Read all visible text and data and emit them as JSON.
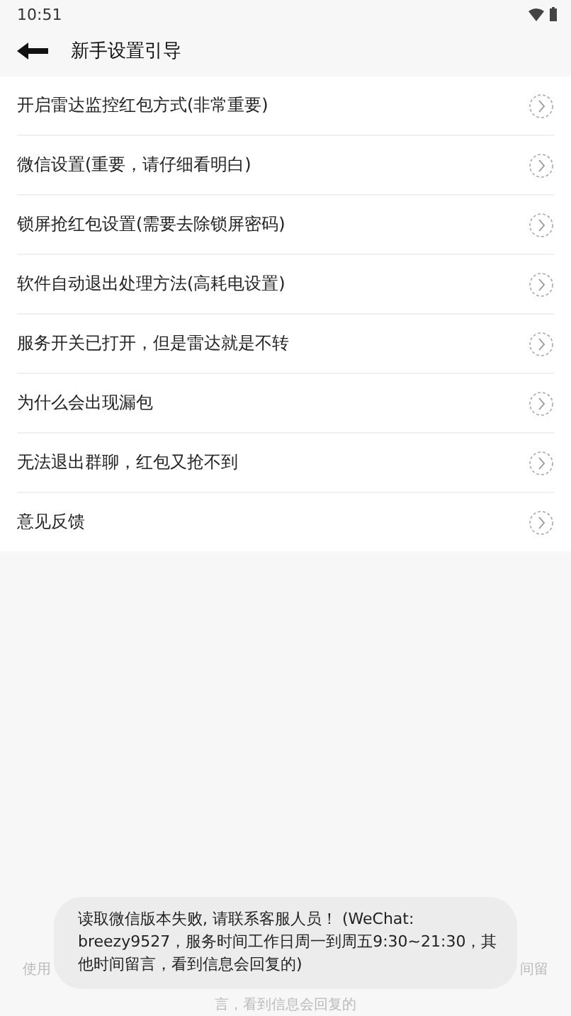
{
  "status_bar": {
    "time": "10:51"
  },
  "header": {
    "title": "新手设置引导"
  },
  "items": [
    {
      "label": "开启雷达监控红包方式(非常重要)"
    },
    {
      "label": "微信设置(重要，请仔细看明白)"
    },
    {
      "label": "锁屏抢红包设置(需要去除锁屏密码)"
    },
    {
      "label": "软件自动退出处理方法(高耗电设置)"
    },
    {
      "label": "服务开关已打开，但是雷达就是不转"
    },
    {
      "label": "为什么会出现漏包"
    },
    {
      "label": "无法退出群聊，红包又抢不到"
    },
    {
      "label": "意见反馈"
    }
  ],
  "footer": {
    "left_fragment": "使用",
    "right_fragment": "间留",
    "second_line": "言，看到信息会回复的"
  },
  "toast": {
    "message": "读取微信版本失败, 请联系客服人员！ (WeChat: breezy9527，服务时间工作日周一到周五9:30~21:30，其他时间留言，看到信息会回复的)"
  }
}
